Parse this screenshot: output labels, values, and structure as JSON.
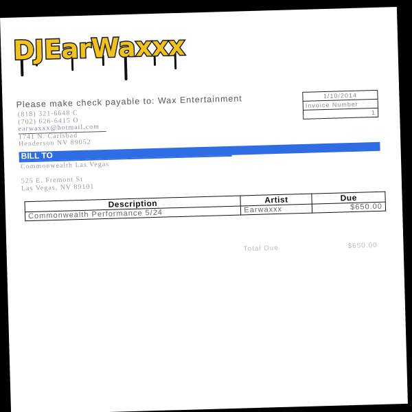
{
  "brand": {
    "logo_text": "DJEarWaxxx",
    "colors": {
      "fill": "#f2c21b",
      "outline": "#1a1a1a"
    }
  },
  "sender": {
    "payable_line": "Please make check payable to: Wax Entertainment",
    "phone_1": "(818) 321-6648 C",
    "phone_2": "(702) 626-6415 O",
    "email": "earwaxxx@hotmail.com",
    "street": "1741 N. Carlsbad",
    "city_line": "Henderson NV 89052"
  },
  "invoice_meta": {
    "date": "1/10/2014",
    "number_label": "Invoice Number",
    "number": "1"
  },
  "bill_to": {
    "heading": "BILL TO",
    "name": "Commonwealth Las Vegas",
    "street": "525 E. Fremont St",
    "city_line": "Las Vegas, NV 89101"
  },
  "table": {
    "headers": [
      "Description",
      "Artist",
      "Due"
    ],
    "rows": [
      {
        "description": "Commonwealth Performance 5/24",
        "artist": "Earwaxxx",
        "due": "$650.00"
      }
    ]
  },
  "totals": {
    "label": "Total Due",
    "value": "$650.00"
  },
  "colors": {
    "accent": "#2e6de4",
    "page": "#ffffff",
    "background": "#000000"
  }
}
